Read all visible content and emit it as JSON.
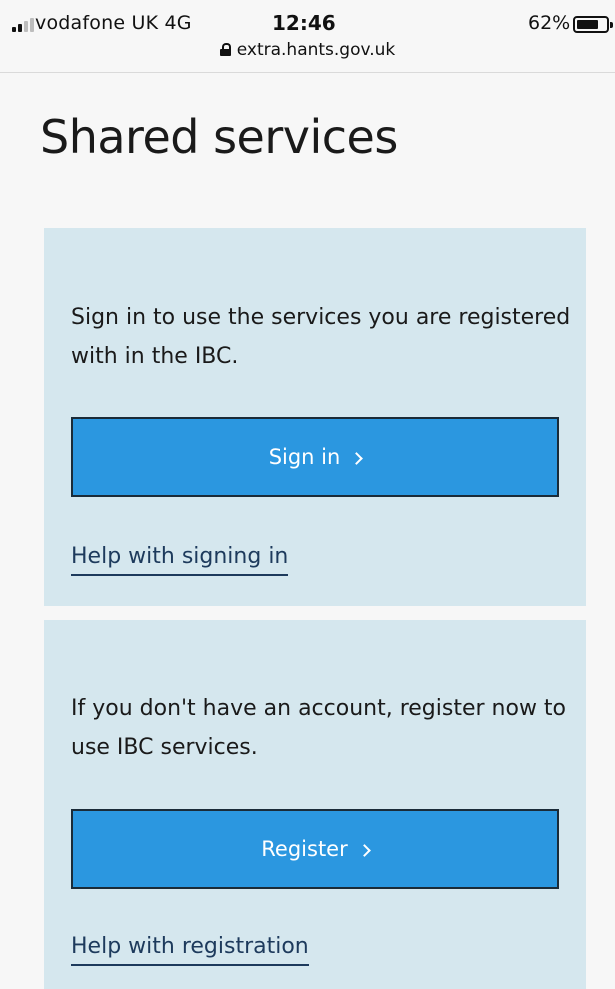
{
  "status_bar": {
    "carrier": "vodafone UK  4G",
    "time": "12:46",
    "battery_percent": "62%",
    "battery_level": 0.62,
    "signal_bars_active": 2,
    "url": "extra.hants.gov.uk",
    "icons": [
      "signal-icon",
      "lock-icon",
      "battery-icon"
    ]
  },
  "page": {
    "title": "Shared services"
  },
  "sign_in_panel": {
    "text": "Sign in to use the services you are registered with in the IBC.",
    "button_label": "Sign in",
    "help_link": "Help with signing in"
  },
  "register_panel": {
    "text": "If you don't have an account, register now to use IBC services.",
    "button_label": "Register",
    "help_link": "Help with registration"
  },
  "colors": {
    "background": "#f7f7f7",
    "panel": "#d5e7ee",
    "button": "#2b97e0",
    "button_border": "#1a2b38",
    "link": "#1d3a5c",
    "top_link": "#2f4cf0"
  }
}
